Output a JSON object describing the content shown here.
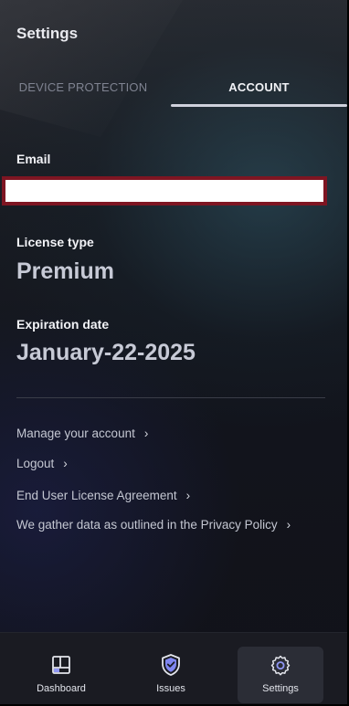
{
  "header": {
    "title": "Settings"
  },
  "tabs": [
    {
      "label": "DEVICE PROTECTION",
      "active": false
    },
    {
      "label": "ACCOUNT",
      "active": true
    }
  ],
  "account": {
    "email_label": "Email",
    "email_value": "",
    "license_label": "License type",
    "license_value": "Premium",
    "expiration_label": "Expiration date",
    "expiration_value": "January-22-2025"
  },
  "links": [
    {
      "label": "Manage your account",
      "chevron": "›"
    },
    {
      "label": "Logout",
      "chevron": "›"
    },
    {
      "label": "End User License Agreement",
      "chevron": "›"
    },
    {
      "label": "We gather data as outlined in the Privacy Policy",
      "chevron": "›"
    }
  ],
  "bottom_nav": [
    {
      "label": "Dashboard",
      "icon": "dashboard-icon",
      "active": false
    },
    {
      "label": "Issues",
      "icon": "shield-check-icon",
      "active": false
    },
    {
      "label": "Settings",
      "icon": "gear-icon",
      "active": true
    }
  ],
  "colors": {
    "accent_underline": "#cfd1dc",
    "email_highlight_border": "#7e1522",
    "shield_icon": "#7f86f0"
  }
}
